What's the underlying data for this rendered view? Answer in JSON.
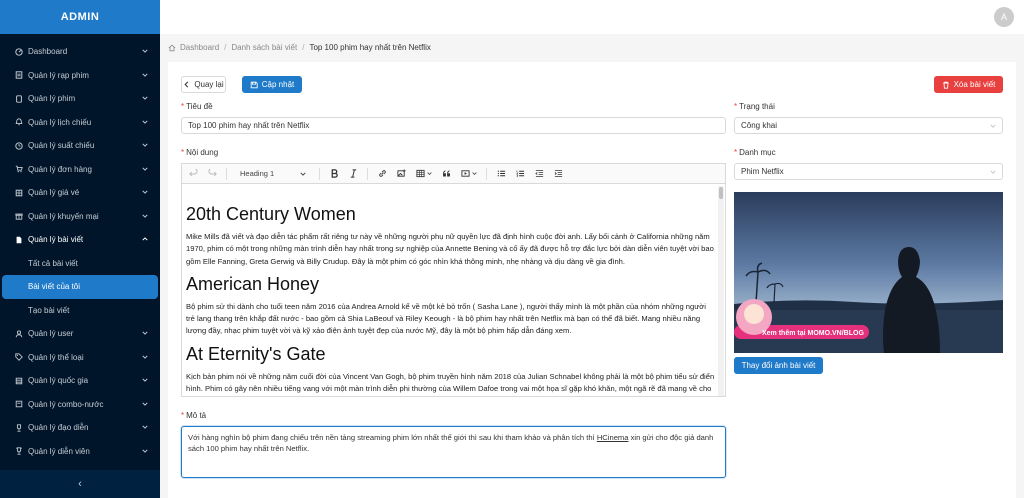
{
  "sidebar": {
    "brand": "ADMIN",
    "items": [
      {
        "label": "Dashboard",
        "icon": "dashboard-icon"
      },
      {
        "label": "Quản lý rạp phim",
        "icon": "cinema-icon"
      },
      {
        "label": "Quản lý phim",
        "icon": "film-icon"
      },
      {
        "label": "Quản lý lịch chiếu",
        "icon": "schedule-icon"
      },
      {
        "label": "Quản lý suất chiếu",
        "icon": "clock-icon"
      },
      {
        "label": "Quản lý đơn hàng",
        "icon": "cart-icon"
      },
      {
        "label": "Quản lý giá vé",
        "icon": "ticket-icon"
      },
      {
        "label": "Quản lý khuyến mại",
        "icon": "gift-icon"
      },
      {
        "label": "Quản lý bài viết",
        "icon": "document-icon"
      }
    ],
    "subitems": [
      {
        "label": "Tất cả bài viết"
      },
      {
        "label": "Bài viết của tôi"
      },
      {
        "label": "Tạo bài viết"
      }
    ],
    "items_after": [
      {
        "label": "Quản lý user",
        "icon": "user-icon"
      },
      {
        "label": "Quản lý thể loại",
        "icon": "tag-icon"
      },
      {
        "label": "Quản lý quốc gia",
        "icon": "globe-icon"
      },
      {
        "label": "Quản lý combo-nước",
        "icon": "combo-icon"
      },
      {
        "label": "Quản lý đạo diễn",
        "icon": "director-icon"
      },
      {
        "label": "Quản lý diễn viên",
        "icon": "trophy-icon"
      }
    ],
    "collapse": "‹"
  },
  "topbar": {
    "avatar": "A"
  },
  "breadcrumb": {
    "home": "Dashboard",
    "list": "Danh sách bài viết",
    "current": "Top 100 phim hay nhất trên Netflix"
  },
  "actions": {
    "back": "Quay lại",
    "update": "Cập nhật",
    "delete": "Xóa bài viết",
    "change_image": "Thay đổi ảnh bài viết"
  },
  "form": {
    "title_label": "Tiêu đề",
    "title_value": "Top 100 phim hay nhất trên Netflix",
    "content_label": "Nội dung",
    "status_label": "Trạng thái",
    "status_value": "Công khai",
    "category_label": "Danh mục",
    "category_value": "Phim Netflix",
    "desc_label": "Mô tả",
    "desc_before": "Với hàng nghìn bộ phim đang chiếu trên nền tảng streaming phim lớn nhất thế giới thì sau khi tham khảo và phân tích thì ",
    "desc_brand": "HCinema",
    "desc_after": " xin gửi cho độc giả danh sách 100 phim hay nhất trên Netflix."
  },
  "editor": {
    "heading_select": "Heading 1",
    "sections": [
      {
        "heading": "20th Century Women",
        "body": "Mike Mills đã viết và đạo diễn tác phẩm rất riêng tư này về những người phụ nữ quyền lực đã định hình cuộc đời anh. Lấy bối cảnh ở California những năm 1970, phim có một trong những màn trình diễn hay nhất trong sự nghiệp của Annette Bening và cố ấy đã được hỗ trợ đắc lực bởi dàn diễn viên tuyệt vời bao gồm Elle Fanning, Greta Gerwig và Billy Crudup. Đây là một phim có góc nhìn khá thông minh, nhẹ nhàng và dịu dàng về gia đình."
      },
      {
        "heading": "American Honey",
        "body": "Bộ phim sử thi dành cho tuổi teen năm 2016 của Andrea Arnold kể về một kẻ bỏ trốn ( Sasha Lane ), người thấy mình là một phần của nhóm những người trẻ lang thang trên khắp đất nước - bao gồm cả Shia LaBeouf và Riley Keough - là bộ phim hay nhất trên Netflix mà bạn có thể đã biết. Mang nhiều năng lượng đầy, nhạc phim tuyệt vời và kỹ xảo điện ảnh tuyệt đẹp của nước Mỹ, đây là một bộ phim hấp dẫn đáng xem."
      },
      {
        "heading": "At Eternity's Gate",
        "body": "Kịch bản phim nói về những năm cuối đời của Vincent Van Gogh, bộ phim truyền hình năm 2018 của Julian Schnabel không phải là một bộ phim tiểu sử điển hình. Phim có gây nên nhiều tiếng vang với một màn trình diễn phi thường của Willem Dafoe trong vai một họa sĩ gặp khó khăn, một ngã rẽ đã mang về cho ông ấy đề cử Oscar lần thứ tư."
      }
    ]
  },
  "image": {
    "banner_text": "Xem thêm tại MOMO.VN/BLOG"
  },
  "colors": {
    "primary": "#1f7ac9",
    "danger": "#e8403f",
    "sidebar_bg": "#001529"
  }
}
